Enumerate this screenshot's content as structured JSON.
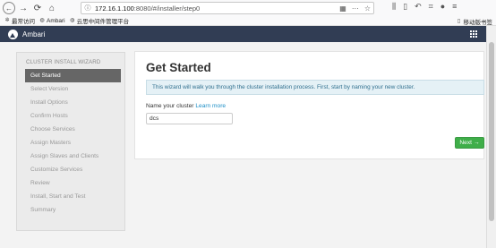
{
  "browser": {
    "url_host": "172.16.1.100",
    "url_path": ":8080/#/installer/step0",
    "bookmarks": [
      "最常访问",
      "Ambari",
      "云思中间件管理平台"
    ],
    "mobile_bookmarks": "移动版书签"
  },
  "app": {
    "name": "Ambari"
  },
  "wizard": {
    "title": "CLUSTER INSTALL WIZARD",
    "steps": [
      "Get Started",
      "Select Version",
      "Install Options",
      "Confirm Hosts",
      "Choose Services",
      "Assign Masters",
      "Assign Slaves and Clients",
      "Customize Services",
      "Review",
      "Install, Start and Test",
      "Summary"
    ],
    "active_index": 0
  },
  "content": {
    "title": "Get Started",
    "info": "This wizard will walk you through the cluster installation process. First, start by naming your new cluster.",
    "cluster_label": "Name your cluster",
    "learn_more": "Learn more",
    "cluster_value": "dcs",
    "next_label": "Next",
    "next_arrow": "→"
  },
  "colors": {
    "header": "#313d54",
    "active_step": "#666666",
    "next_button": "#3fae49",
    "info_bg": "#e5f1f6",
    "link": "#1b8ec6"
  }
}
